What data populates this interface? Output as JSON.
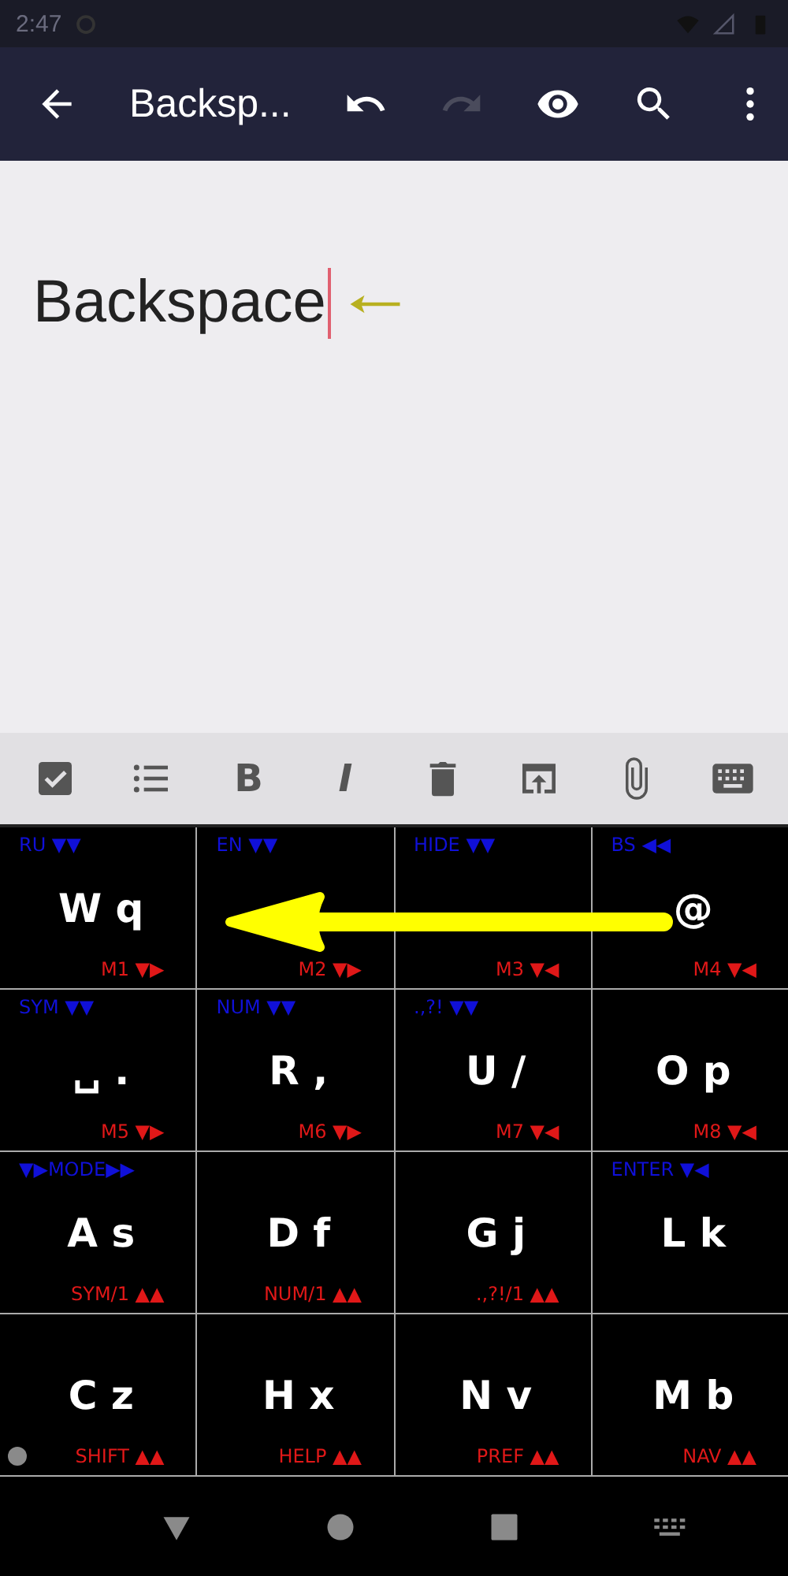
{
  "status_bar": {
    "time": "2:47"
  },
  "app_bar": {
    "title": "Backsp...",
    "actions": [
      {
        "kind": "undo",
        "disabled": false
      },
      {
        "kind": "redo",
        "disabled": true
      },
      {
        "kind": "eye",
        "disabled": false
      },
      {
        "kind": "search",
        "disabled": false
      },
      {
        "kind": "more",
        "disabled": false
      }
    ]
  },
  "editor": {
    "text": "Backspace"
  },
  "format_toolbar": [
    {
      "kind": "checkbox"
    },
    {
      "kind": "list"
    },
    {
      "kind": "bold",
      "label": "B"
    },
    {
      "kind": "italic",
      "label": "I"
    },
    {
      "kind": "trash"
    },
    {
      "kind": "share"
    },
    {
      "kind": "clip"
    },
    {
      "kind": "keyboard"
    }
  ],
  "keyboard": {
    "keys": [
      {
        "top": "RU ▼▼",
        "main": "W q",
        "bottom": "M1 ▼▶"
      },
      {
        "top": "EN ▼▼",
        "bottom": "M2 ▼▶"
      },
      {
        "top": "HIDE ▼▼",
        "bottom": "M3 ▼◀"
      },
      {
        "top": "BS ◀◀",
        "main": "@",
        "bottom": "M4 ▼◀"
      },
      {
        "top": "SYM ▼▼",
        "main": "␣ .",
        "bottom": "M5 ▼▶"
      },
      {
        "top": "NUM ▼▼",
        "main": "R ,",
        "bottom": "M6 ▼▶"
      },
      {
        "top": ".,?! ▼▼",
        "main": "U /",
        "bottom": "M7 ▼◀"
      },
      {
        "main": "O p",
        "bottom": "M8 ▼◀"
      },
      {
        "top": "▼▶MODE▶▶",
        "main": "A s",
        "bottom": "SYM/1 ▲▲"
      },
      {
        "main": "D f",
        "bottom": "NUM/1 ▲▲"
      },
      {
        "main": "G j",
        "bottom": ".,?!/1 ▲▲"
      },
      {
        "top": "ENTER ▼◀",
        "main": "L k"
      },
      {
        "main": "C z",
        "bottom": "SHIFT ▲▲",
        "indicator": true
      },
      {
        "main": "H x",
        "bottom": "HELP ▲▲"
      },
      {
        "main": "N v",
        "bottom": "PREF ▲▲"
      },
      {
        "main": "M b",
        "bottom": "NAV ▲▲"
      }
    ]
  },
  "nav_bar": [
    {
      "kind": "back"
    },
    {
      "kind": "home"
    },
    {
      "kind": "recents"
    },
    {
      "kind": "keyboard"
    }
  ]
}
